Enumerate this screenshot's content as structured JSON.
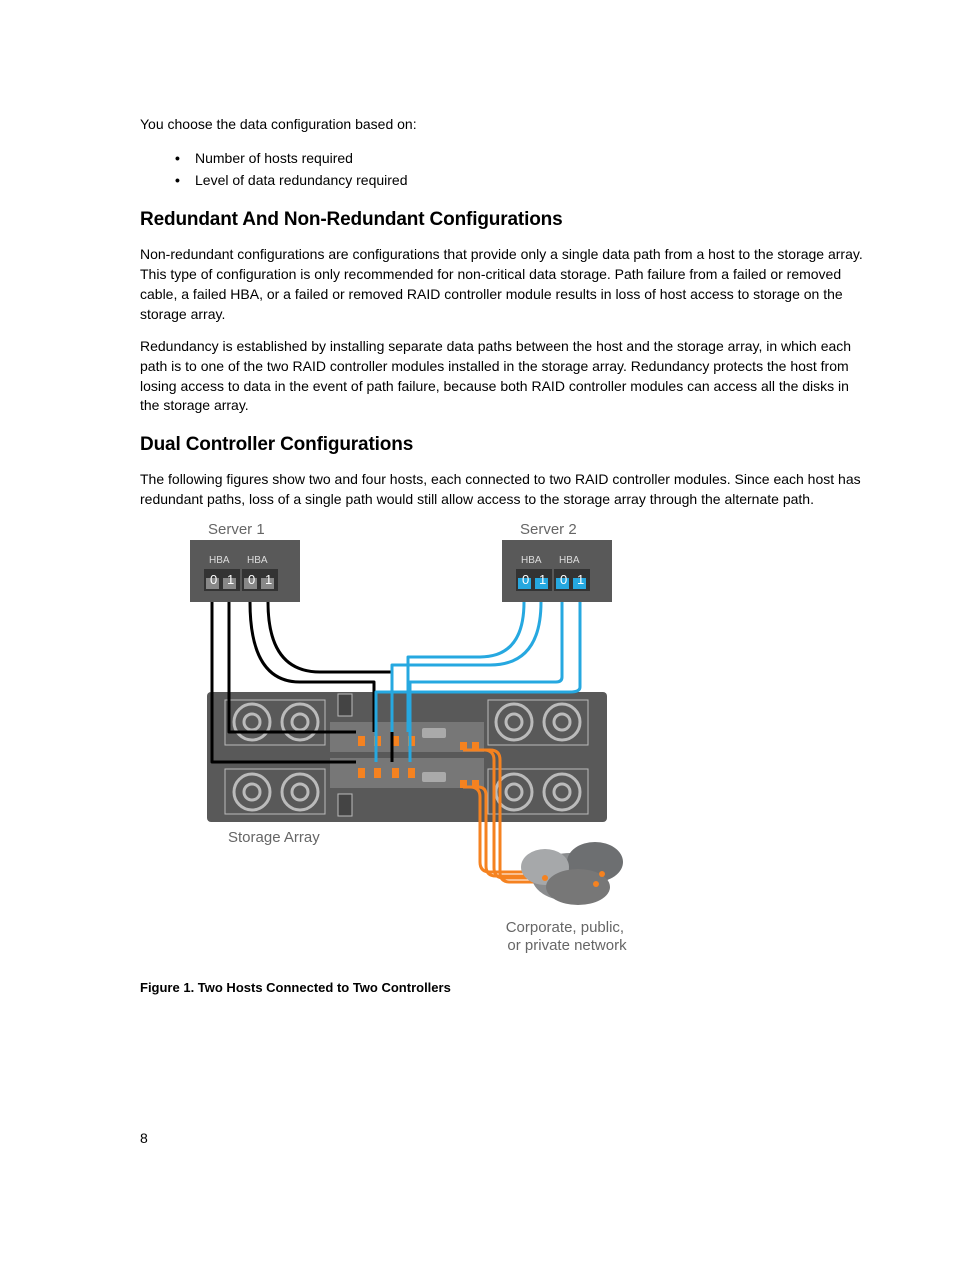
{
  "intro": "You choose the data configuration based on:",
  "bullets": [
    "Number of hosts required",
    "Level of data redundancy required"
  ],
  "section1": {
    "title": "Redundant And Non-Redundant Configurations",
    "p1": "Non-redundant configurations are configurations that provide only a single data path from a host to the storage array. This type of configuration is only recommended for non-critical data storage. Path failure from a failed or removed cable, a failed HBA, or a failed or removed RAID controller module results in loss of host access to storage on the storage array.",
    "p2": "Redundancy is established by installing separate data paths between the host and the storage array, in which each path is to one of the two RAID controller modules installed in the storage array. Redundancy protects the host from losing access to data in the event of path failure, because both RAID controller modules can access all the disks in the storage array."
  },
  "section2": {
    "title": "Dual Controller Configurations",
    "p1": "The following figures show two and four hosts, each connected to two RAID controller modules. Since each host has redundant paths, loss of a single path would still allow access to the storage array through the alternate path."
  },
  "diagram": {
    "server1": "Server 1",
    "server2": "Server 2",
    "hba": "HBA",
    "ports": [
      "0",
      "1"
    ],
    "storage": "Storage Array",
    "network": "Corporate, public, or private network"
  },
  "figure_caption": "Figure 1. Two Hosts Connected to Two Controllers",
  "page_number": "8"
}
